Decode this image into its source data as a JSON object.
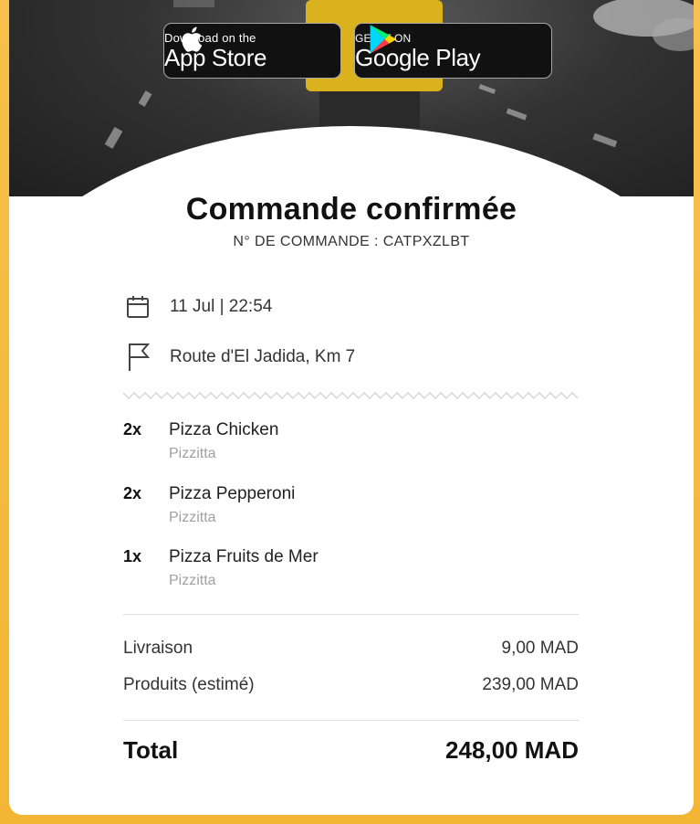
{
  "store_buttons": {
    "appstore": {
      "small": "Download on the",
      "big": "App Store"
    },
    "googleplay": {
      "small": "GET IT ON",
      "big": "Google Play"
    }
  },
  "order": {
    "title": "Commande confirmée",
    "number_label": "N° DE COMMANDE : CATPXZLBT",
    "datetime": "11 Jul | 22:54",
    "address": "Route d'El Jadida, Km 7"
  },
  "items": [
    {
      "qty": "2x",
      "name": "Pizza Chicken",
      "restaurant": "Pizzitta"
    },
    {
      "qty": "2x",
      "name": "Pizza Pepperoni",
      "restaurant": "Pizzitta"
    },
    {
      "qty": "1x",
      "name": "Pizza Fruits de Mer",
      "restaurant": "Pizzitta"
    }
  ],
  "summary": {
    "delivery_label": "Livraison",
    "delivery_value": "9,00 MAD",
    "products_label": "Produits (estimé)",
    "products_value": "239,00 MAD",
    "total_label": "Total",
    "total_value": "248,00 MAD"
  },
  "icons": {
    "date": "calendar-icon",
    "address": "flag-icon",
    "appstore": "apple-icon",
    "googleplay": "google-play-icon"
  },
  "colors": {
    "background": "#f5b93d",
    "card": "#ffffff",
    "text": "#111111",
    "muted": "#a0a0a0"
  }
}
